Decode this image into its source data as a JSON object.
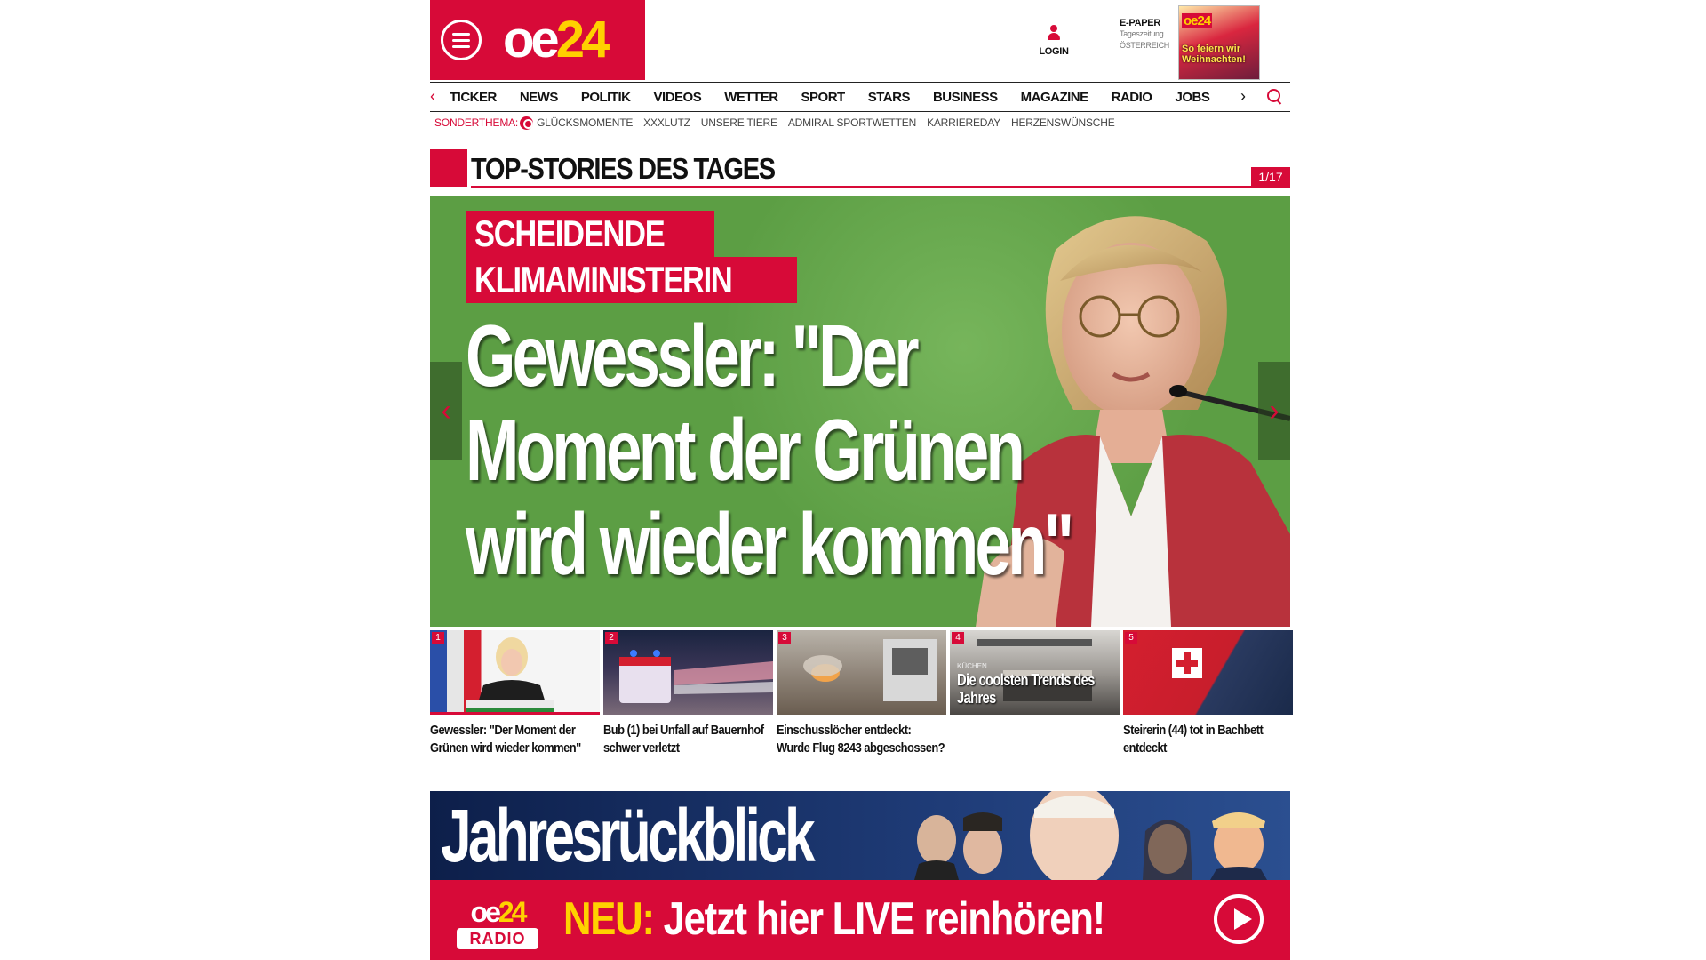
{
  "header": {
    "logo": {
      "part1": "oe",
      "part2": "24"
    },
    "login_label": "LOGIN",
    "epaper": {
      "title": "E-PAPER",
      "line1": "Tageszeitung",
      "line2": "ÖSTERREICH"
    },
    "cover": {
      "logo": "oe24",
      "headline": "So feiern wir Weihnachten!"
    }
  },
  "nav": {
    "items": [
      "TICKER",
      "NEWS",
      "POLITIK",
      "VIDEOS",
      "WETTER",
      "SPORT",
      "STARS",
      "BUSINESS",
      "MAGAZINE",
      "RADIO",
      "JOBS"
    ]
  },
  "subnav": {
    "label": "SONDERTHEMA:",
    "items": [
      "GLÜCKSMOMENTE",
      "XXXLUTZ",
      "UNSERE TIERE",
      "ADMIRAL SPORTWETTEN",
      "KARRIEREDAY",
      "HERZENSWÜNSCHE"
    ]
  },
  "section": {
    "title": "TOP-STORIES DES TAGES",
    "counter": "1/17"
  },
  "hero": {
    "kicker_line1": "SCHEIDENDE",
    "kicker_line2": "KLIMAMINISTERIN",
    "headline_line1": "Gewessler: \"Der",
    "headline_line2": "Moment der Grünen",
    "headline_line3": "wird wieder kommen\"",
    "prev_icon": "‹",
    "next_icon": "›"
  },
  "thumbs": [
    {
      "num": "1",
      "caption": "Gewessler: \"Der Moment der Grünen wird wieder kommen\""
    },
    {
      "num": "2",
      "caption": "Bub (1) bei Unfall auf Bauernhof schwer verletzt"
    },
    {
      "num": "3",
      "caption": "Einschusslöcher entdeckt: Wurde Flug 8243 abgeschossen?"
    },
    {
      "num": "4",
      "ad_kicker": "KÜCHEN",
      "ad_text": "Die coolsten Trends des Jahres",
      "caption": ""
    },
    {
      "num": "5",
      "caption": "Steirerin (44) tot in Bachbett entdeckt"
    }
  ],
  "promo": {
    "title": "Jahresrückblick"
  },
  "radio": {
    "logo_oe": "oe",
    "logo_24": "24",
    "logo_radio": "RADIO",
    "neu": "NEU:",
    "text": " Jetzt hier LIVE reinhören!"
  },
  "colors": {
    "brand_red": "#d70a38",
    "brand_yellow": "#ffd100",
    "hero_green": "#5c9e44"
  }
}
